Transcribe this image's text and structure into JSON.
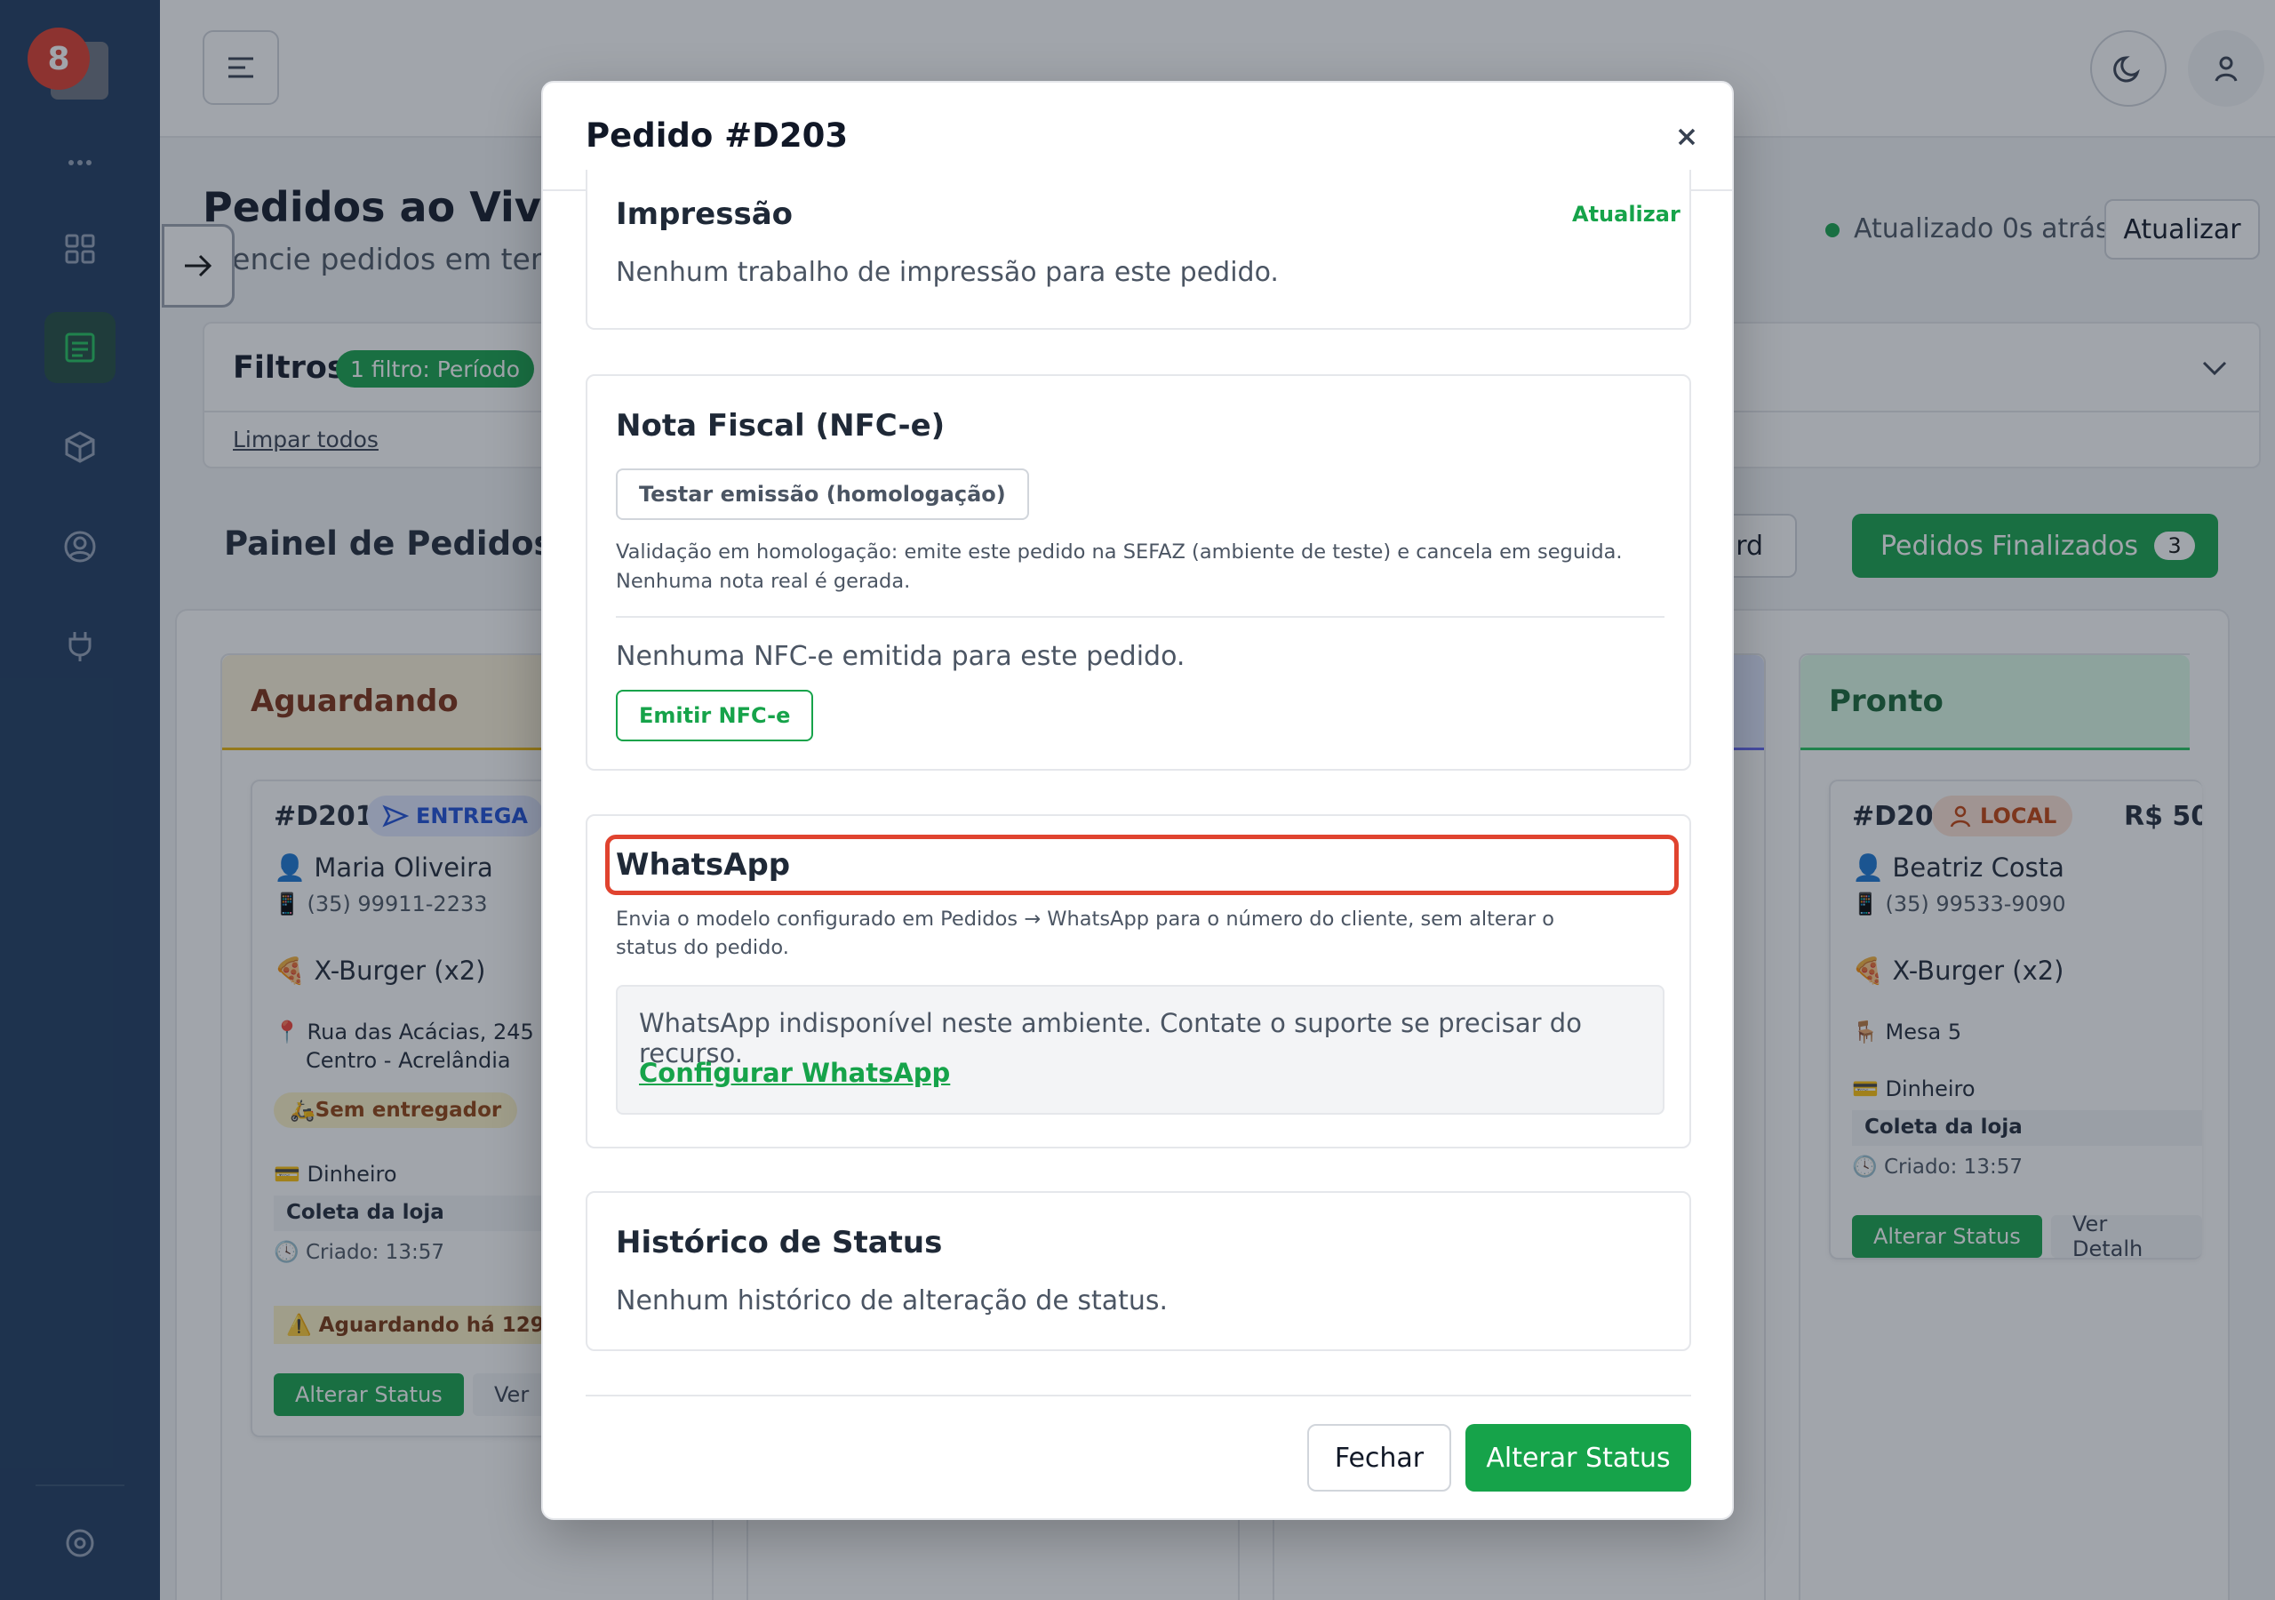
{
  "sidebar": {
    "badge": "8",
    "more": "•••"
  },
  "header": {
    "page_title": "Pedidos ao Vivo",
    "page_subtitle": "erencie pedidos em tem",
    "updated": "Atualizado 0s atrás",
    "refresh": "Atualizar"
  },
  "filters": {
    "title": "Filtros",
    "badge": "1 filtro: Período",
    "clear": "Limpar todos"
  },
  "board": {
    "title": "Painel de Pedidos",
    "card_view": "r Card",
    "finalized": "Pedidos Finalizados",
    "finalized_count": "3"
  },
  "columns": [
    {
      "title": "Aguardando",
      "card": {
        "id": "#D201",
        "tag": "ENTREGA",
        "customer": "Maria Oliveira",
        "phone": "(35) 99911-2233",
        "item": "X-Burger (x2)",
        "address1": "Rua das Acácias, 245",
        "address2": "Centro - Acrelândia",
        "courier": "Sem entregador",
        "payment": "Dinheiro",
        "pickup": "Coleta da loja",
        "created": "Criado: 13:57",
        "warning": "Aguardando há 129 m",
        "change_status": "Alterar Status",
        "details": "Ver"
      }
    },
    {
      "title": "Pronto",
      "card": {
        "id": "#D205",
        "tag": "LOCAL",
        "price": "R$ 50",
        "customer": "Beatriz Costa",
        "phone": "(35) 99533-9090",
        "item": "X-Burger (x2)",
        "table": "Mesa 5",
        "payment": "Dinheiro",
        "pickup": "Coleta da loja",
        "created": "Criado: 13:57",
        "change_status": "Alterar Status",
        "details": "Ver Detalh"
      }
    }
  ],
  "modal": {
    "title": "Pedido #D203",
    "print": {
      "title": "Impressão",
      "refresh": "Atualizar",
      "empty": "Nenhum trabalho de impressão para este pedido."
    },
    "nfce": {
      "title": "Nota Fiscal (NFC-e)",
      "test_button": "Testar emissão (homologação)",
      "help_line1": "Validação em homologação: emite este pedido na SEFAZ (ambiente de teste) e cancela em seguida.",
      "help_line2": "Nenhuma nota real é gerada.",
      "empty": "Nenhuma NFC-e emitida para este pedido.",
      "emit_button": "Emitir NFC-e"
    },
    "whatsapp": {
      "title": "WhatsApp",
      "help_line1": "Envia o modelo configurado em Pedidos → WhatsApp para o número do cliente, sem alterar o",
      "help_line2": "status do pedido.",
      "unavailable": "WhatsApp indisponível neste ambiente. Contate o suporte se precisar do recurso.",
      "configure": "Configurar WhatsApp"
    },
    "history": {
      "title": "Histórico de Status",
      "empty": "Nenhum histórico de alteração de status."
    },
    "footer": {
      "close": "Fechar",
      "change_status": "Alterar Status"
    }
  }
}
